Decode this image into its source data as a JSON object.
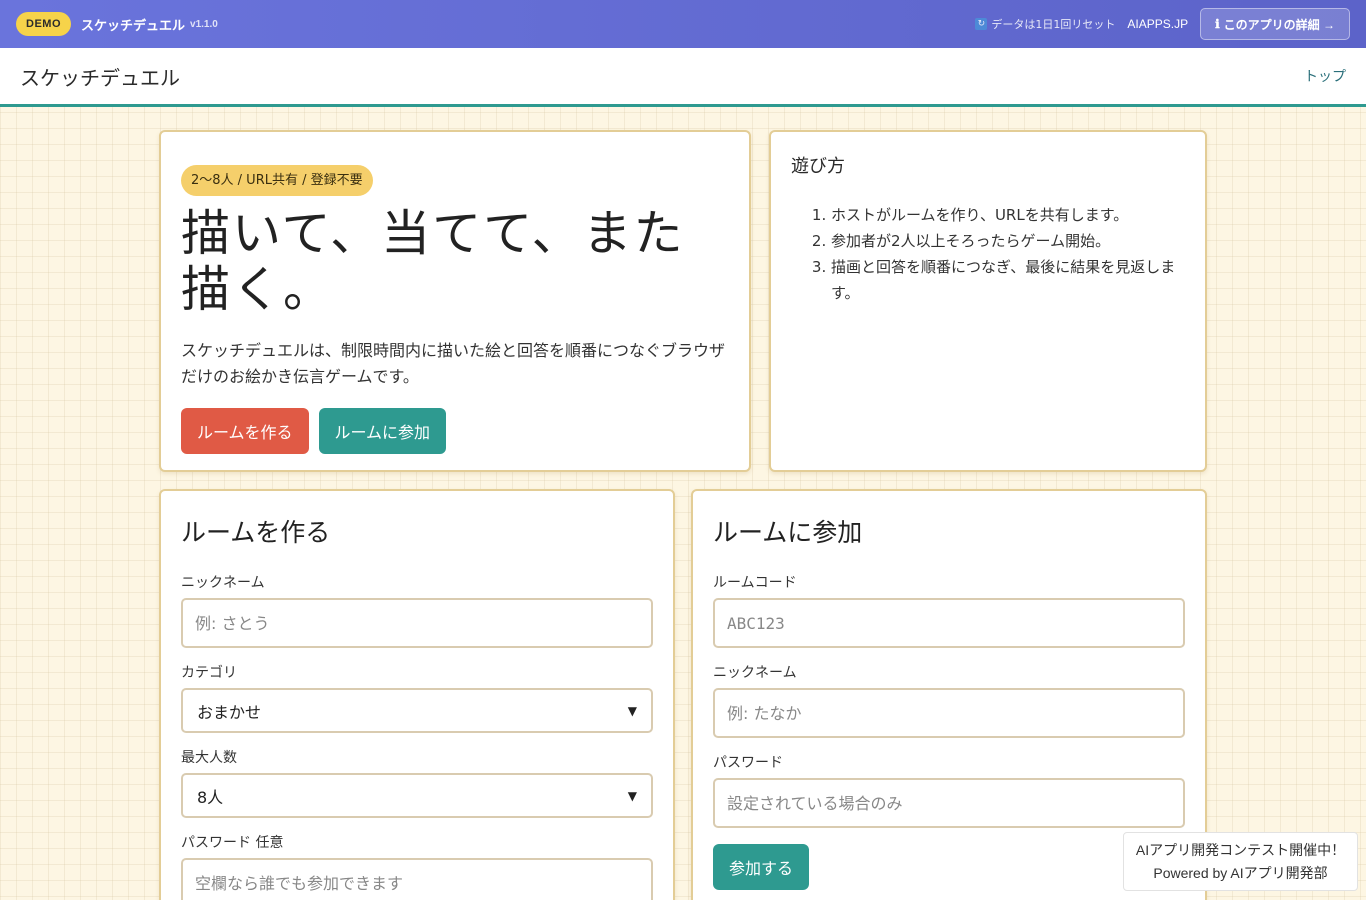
{
  "demo_bar": {
    "badge": "DEMO",
    "app_name": "スケッチデュエル",
    "version": "v1.1.0",
    "reset_icon": "🔄",
    "reset_note": "データは1日1回リセット",
    "aiapps_link": "AIAPPS.JP",
    "detail_icon": "ℹ",
    "detail_button": "このアプリの詳細 →"
  },
  "header": {
    "title": "スケッチデュエル",
    "top_link": "トップ"
  },
  "hero": {
    "pill": "2〜8人 / URL共有 / 登録不要",
    "headline": "描いて、当てて、また描く。",
    "lead": "スケッチデュエルは、制限時間内に描いた絵と回答を順番につなぐブラウザだけのお絵かき伝言ゲームです。",
    "create_button": "ルームを作る",
    "join_button": "ルームに参加"
  },
  "howto": {
    "title": "遊び方",
    "steps": [
      "ホストがルームを作り、URLを共有します。",
      "参加者が2人以上そろったらゲーム開始。",
      "描画と回答を順番につなぎ、最後に結果を見返します。"
    ]
  },
  "create_room": {
    "title": "ルームを作る",
    "nickname_label": "ニックネーム",
    "nickname_placeholder": "例: さとう",
    "category_label": "カテゴリ",
    "category_value": "おまかせ",
    "max_players_label": "最大人数",
    "max_players_value": "8人",
    "password_label": "パスワード 任意",
    "password_placeholder": "空欄なら誰でも参加できます"
  },
  "join_room": {
    "title": "ルームに参加",
    "room_code_label": "ルームコード",
    "room_code_placeholder": "ABC123",
    "nickname_label": "ニックネーム",
    "nickname_placeholder": "例: たなか",
    "password_label": "パスワード",
    "password_placeholder": "設定されている場合のみ",
    "submit_button": "参加する"
  },
  "contest": {
    "line1": "AIアプリ開発コンテスト開催中！",
    "line2": "Powered by AIアプリ開発部"
  },
  "colors": {
    "demo_bar": "#6a74dc",
    "accent_teal": "#2e9a90",
    "accent_red": "#e05a45",
    "pill_yellow": "#f5cf6b",
    "card_border": "#e3cd96",
    "background": "#fdf6e3"
  }
}
